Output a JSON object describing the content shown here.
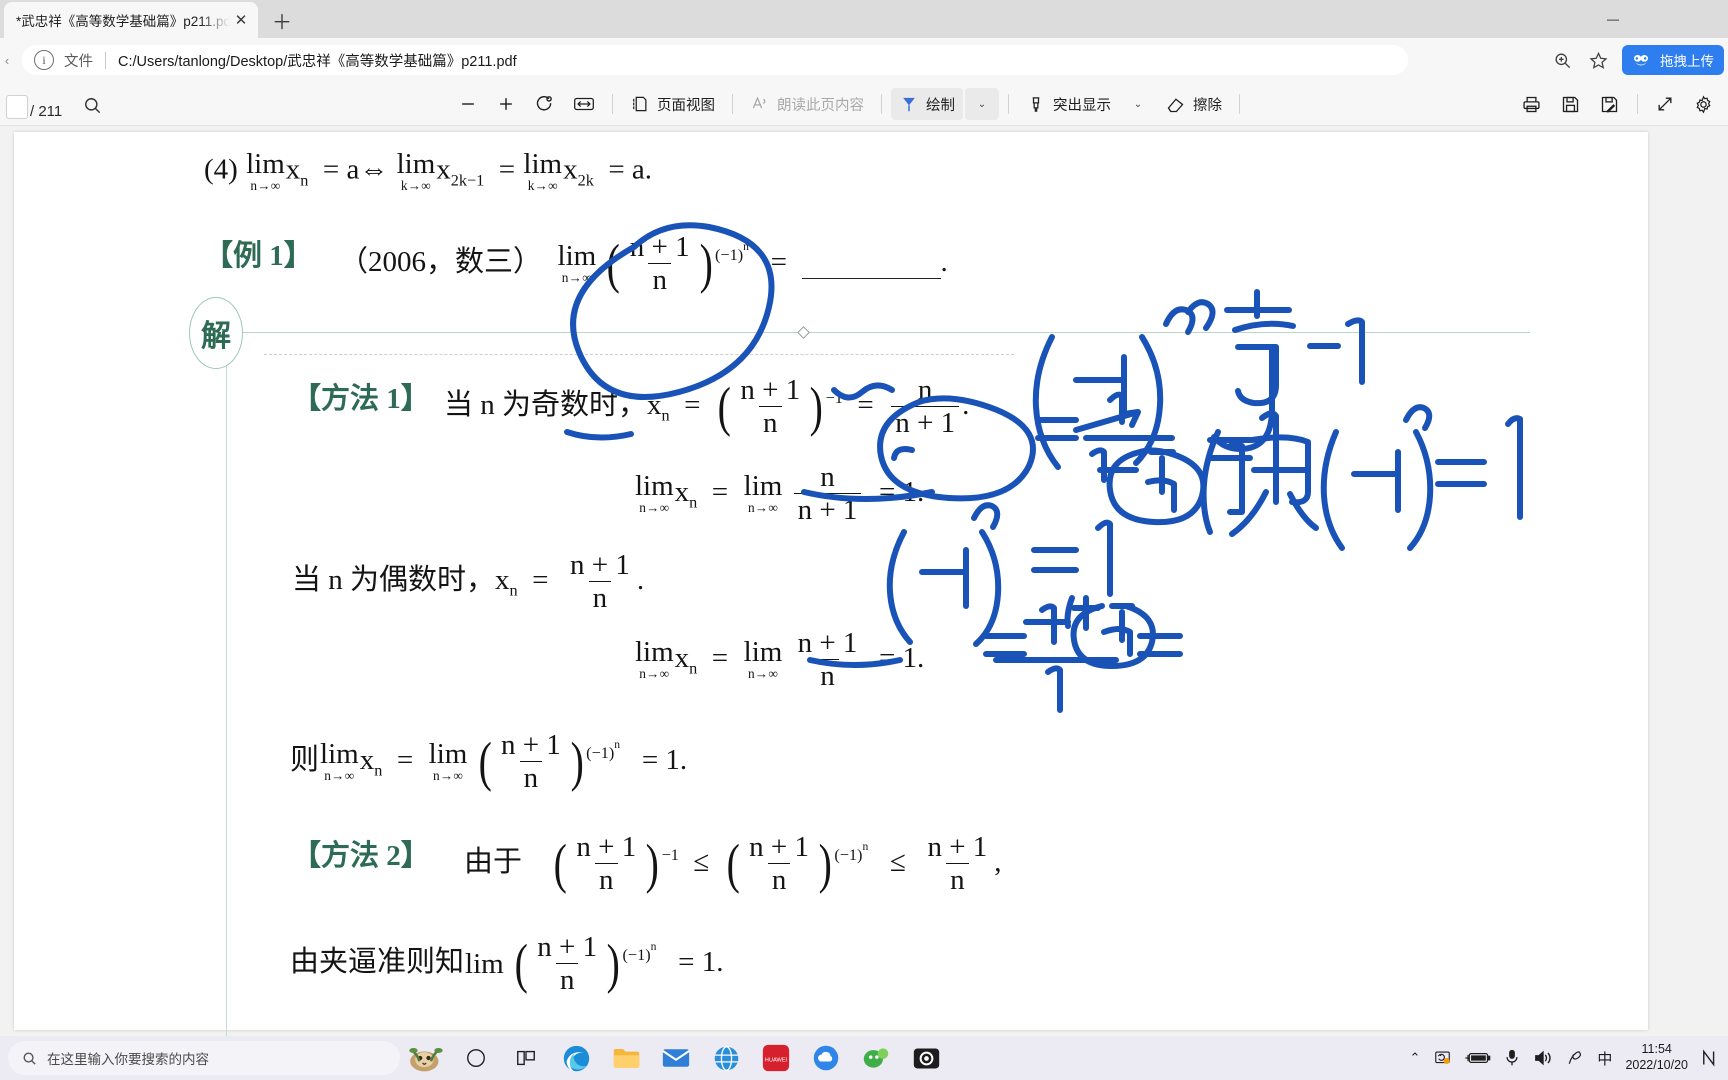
{
  "browser": {
    "tab": {
      "title": "*武忠祥《高等数学基础篇》p211.pdf",
      "close_label": "✕"
    },
    "new_tab_label": "＋",
    "window_controls": {
      "minimize": "—",
      "maximize": "▢",
      "close": "✕"
    },
    "address_bar": {
      "info_icon_glyph": "i",
      "scheme_label": "文件",
      "divider": "|",
      "url": "C:/Users/tanlong/Desktop/武忠祥《高等数学基础篇》p211.pdf"
    },
    "address_actions": {
      "zoom_icon": "search-plus-icon",
      "favorite_icon": "star-icon",
      "extension_label": "拖拽上传",
      "extension_color": "#2f7ef0"
    },
    "nav_back_glyph": "‹"
  },
  "pdf_toolbar": {
    "page_current": "",
    "page_total": "/ 211",
    "search_icon": "search-icon",
    "zoom_out": "−",
    "zoom_in": "+",
    "rotate": "↻",
    "fit_width": "↔",
    "page_view_label": "页面视图",
    "read_aloud_label": "朗读此页内容",
    "draw_label": "绘制",
    "highlight_label": "突出显示",
    "erase_label": "擦除",
    "print_icon": "printer-icon",
    "save_icon": "save-icon",
    "save_as_icon": "save-edit-icon",
    "fullscreen_icon": "expand-icon",
    "settings_icon": "gear-icon",
    "chevron": "⌄"
  },
  "document": {
    "solution_marker": "解",
    "lines": {
      "item4_prefix": "(4)",
      "lim_text": "lim",
      "x": "x",
      "eq": "=",
      "a": "a",
      "iff": "⇔",
      "n_to_inf": "n→∞",
      "k_to_inf": "k→∞",
      "sub_n": "n",
      "sub_2k1": "2k−1",
      "sub_2k": "2k",
      "period": ".",
      "example_label": "【例 1】",
      "example_source": "（2006，数三）",
      "blank_answer": "＿＿＿＿＿",
      "method1_label": "【方法 1】",
      "method1_text": "当 n 为奇数时，",
      "method2_label": "【方法 2】",
      "method2_text": "由于",
      "even_text": "当 n 为偶数时，",
      "then_char": "则",
      "numerator_np1": "n + 1",
      "denominator_n": "n",
      "exp_m1": "−1",
      "exp_neg1n": "(−1)",
      "exp_n": "n",
      "result_one": "1.",
      "le": "≤",
      "comma": ",",
      "squeeze_text": "由夹逼准则知",
      "frac_n_over_np1_num": "n",
      "frac_n_over_np1_den": "n + 1"
    }
  },
  "handwriting": {
    "color": "#1a53b8",
    "notes": [
      {
        "id": "note-neg1n-top",
        "text": "(−1)ⁿ"
      },
      {
        "id": "note-odd",
        "text": "奇"
      },
      {
        "id": "note-odd-result",
        "text": "−1"
      },
      {
        "id": "note-even",
        "text": "偶 (−1)ⁿ = 1"
      },
      {
        "id": "note-frac-eq-1",
        "text": "= 1 / (1 + 1/n) = 1"
      },
      {
        "id": "note-neg1n-mid",
        "text": "(−1)ⁿ = 1"
      },
      {
        "id": "note-frac-bottom",
        "text": "= (1 + 1/n) / 1 ="
      }
    ]
  },
  "taskbar": {
    "search_placeholder": "在这里输入你要搜索的内容",
    "search_icon": "search-icon",
    "apps": [
      {
        "name": "sloth-widget",
        "glyph": "🦥"
      },
      {
        "name": "task-view-circle",
        "glyph": "◯"
      },
      {
        "name": "task-view",
        "glyph": "⊞"
      },
      {
        "name": "edge-browser",
        "glyph": "e"
      },
      {
        "name": "file-explorer",
        "glyph": "📁"
      },
      {
        "name": "mail",
        "glyph": "✉"
      },
      {
        "name": "browser-globe",
        "glyph": "🌐"
      },
      {
        "name": "huawei-app",
        "glyph": "HUAWEI"
      },
      {
        "name": "cloud-app",
        "glyph": "☁"
      },
      {
        "name": "green-app",
        "glyph": "●"
      },
      {
        "name": "screen-recorder",
        "glyph": "▣"
      }
    ],
    "tray": {
      "chevron_up": "⌃",
      "sync_icon": "sync-icon",
      "battery_icon": "battery-icon",
      "mic_icon": "microphone-icon",
      "volume_icon": "volume-icon",
      "pen_icon": "pen-icon",
      "ime_label": "中",
      "time": "11:54",
      "date": "2022/10/20",
      "notification_icon": "notification-icon"
    }
  }
}
